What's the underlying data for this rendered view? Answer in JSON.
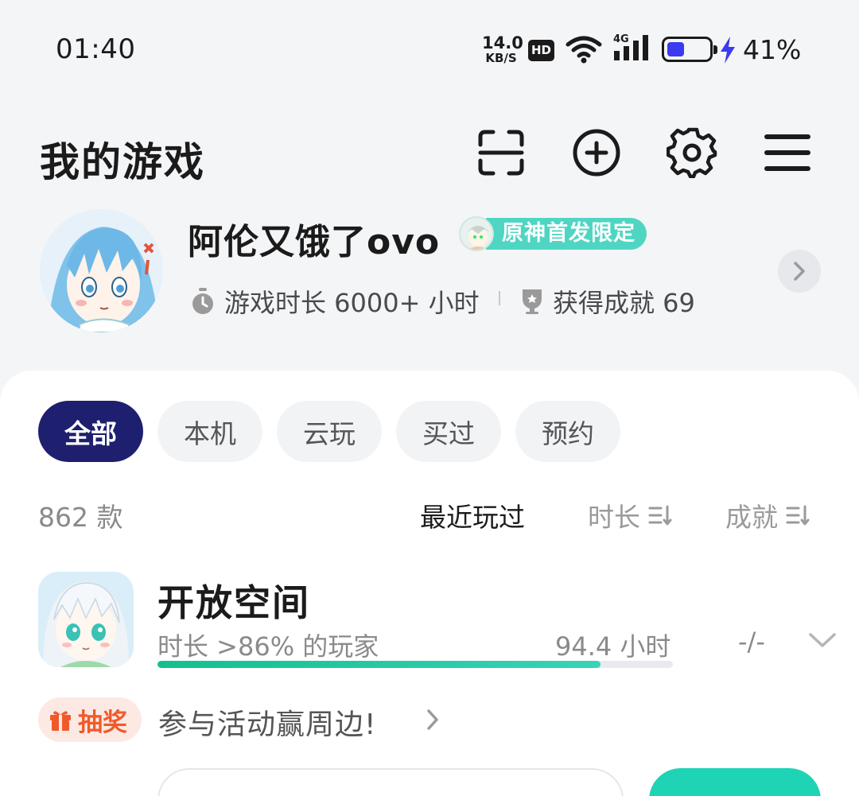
{
  "status_bar": {
    "time": "01:40",
    "net_speed_value": "14.0",
    "net_speed_unit": "KB/S",
    "hd_label": "HD",
    "network_type": "4G",
    "battery_percent": "41%",
    "battery_level": 0.41,
    "charging": true
  },
  "header": {
    "title": "我的游戏",
    "icons": [
      "scan-icon",
      "add-circle-icon",
      "gear-icon",
      "menu-icon"
    ]
  },
  "profile": {
    "username": "阿伦又饿了ovo",
    "badge_label": "原神首发限定",
    "play_time_label": "游戏时长 6000+ 小时",
    "achievements_label": "获得成就 69"
  },
  "filters": {
    "tabs": [
      {
        "label": "全部",
        "active": true
      },
      {
        "label": "本机",
        "active": false
      },
      {
        "label": "云玩",
        "active": false
      },
      {
        "label": "买过",
        "active": false
      },
      {
        "label": "预约",
        "active": false
      }
    ]
  },
  "list_header": {
    "count": "862 款",
    "sort_recent": "最近玩过",
    "sort_duration": "时长",
    "sort_achievement": "成就"
  },
  "games": [
    {
      "title": "开放空间",
      "subtitle": "时长 >86% 的玩家",
      "hours": "94.4 小时",
      "achievements": "-/-",
      "progress": 0.86
    }
  ],
  "lottery": {
    "badge_label": "抽奖",
    "text": "参与活动赢周边!"
  },
  "accent": {
    "primary_dark": "#1e1f6e",
    "teal": "#1fd3b5",
    "orange": "#f05a2a"
  }
}
